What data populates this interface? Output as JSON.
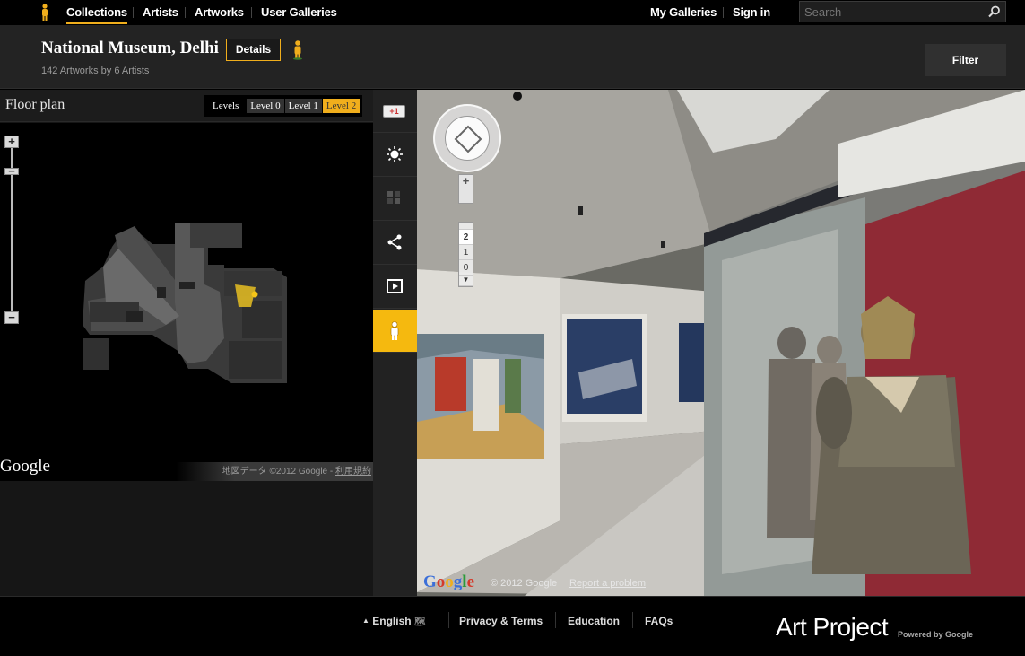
{
  "nav": {
    "links": [
      "Collections",
      "Artists",
      "Artworks",
      "User Galleries"
    ],
    "right_links": [
      "My Galleries",
      "Sign in"
    ],
    "search_placeholder": "Search"
  },
  "header": {
    "title": "National Museum, Delhi",
    "subtitle": "142 Artworks by 6 Artists",
    "details_label": "Details",
    "filter_label": "Filter"
  },
  "floorplan": {
    "title": "Floor plan",
    "levels_label": "Levels",
    "levels": [
      "Level 0",
      "Level 1",
      "Level 2"
    ],
    "active_level": "Level 2",
    "google_logo": "Google",
    "copyright": "地図データ ©2012 Google - ",
    "terms": "利用規約"
  },
  "tools": {
    "gplus_label": "+1",
    "items": [
      "gplus-icon",
      "light-icon",
      "tiles-icon",
      "share-icon",
      "slideshow-icon",
      "pegman-icon"
    ],
    "active": "pegman-icon"
  },
  "streetview": {
    "zoom_in": "+",
    "floors": [
      "2",
      "1",
      "0"
    ],
    "active_floor": "2",
    "google_logo": "Google",
    "copyright": "© 2012 Google",
    "report": "Report a problem"
  },
  "footer": {
    "language": "English",
    "links": [
      "Privacy & Terms",
      "Education",
      "FAQs"
    ],
    "brand": "Art Project",
    "brand_sub": "Powered by Google"
  },
  "colors": {
    "accent": "#f0ae1c",
    "background": "#000000",
    "panel": "#232323"
  }
}
